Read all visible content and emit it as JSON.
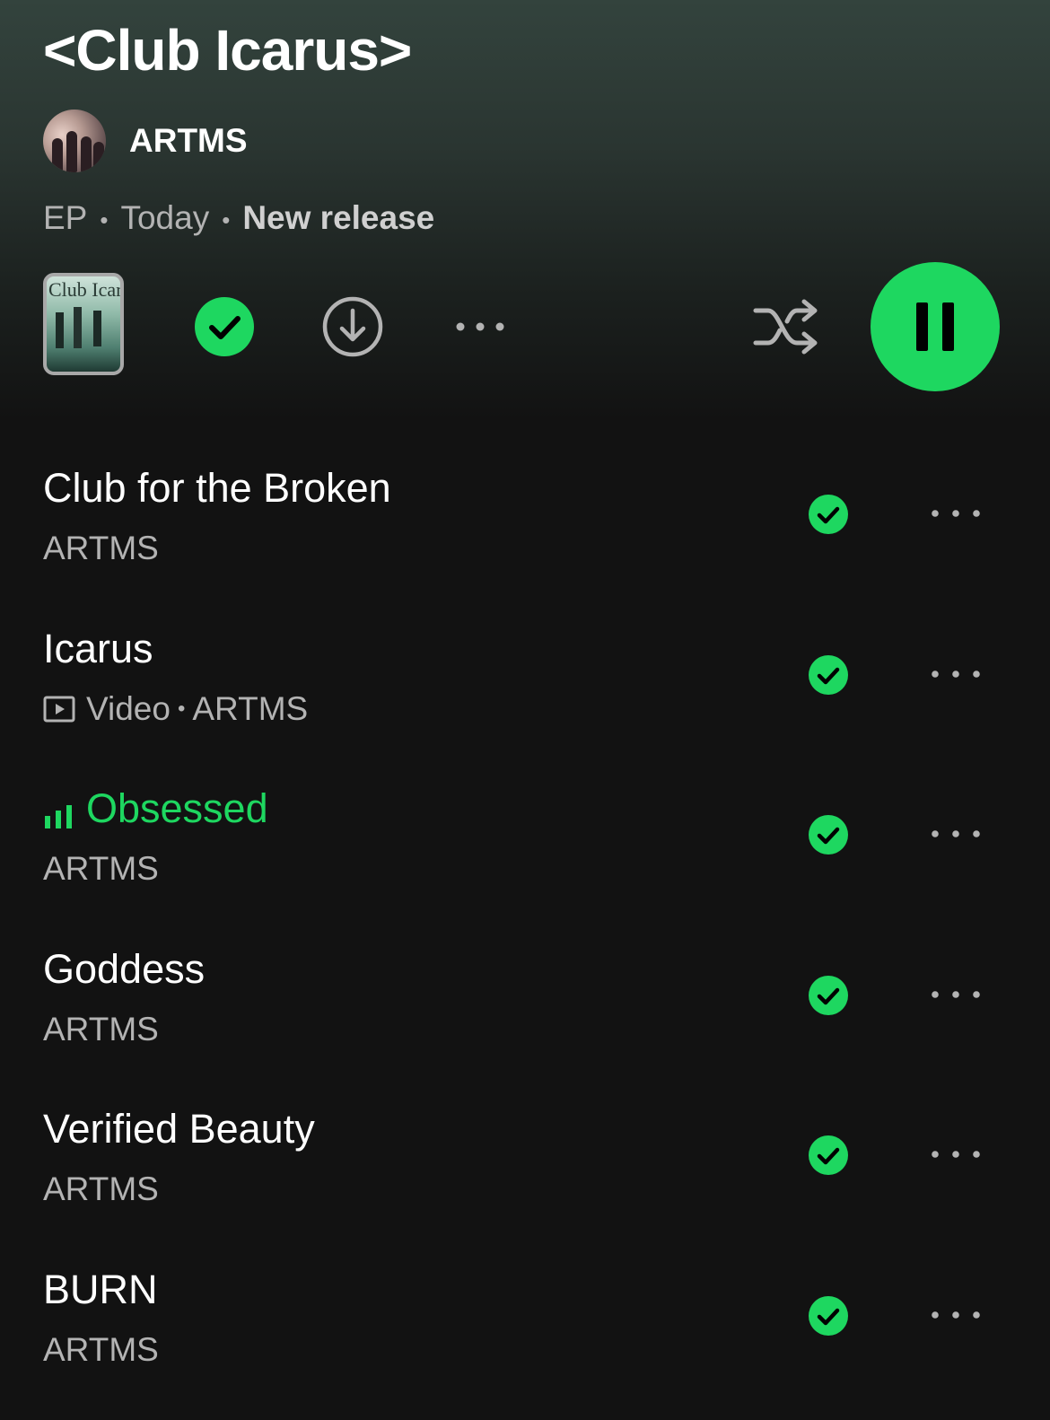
{
  "album": {
    "title": "<Club Icarus>",
    "artist": "ARTMS",
    "type": "EP",
    "date": "Today",
    "tag": "New release",
    "cover_text": "Club Icarus"
  },
  "colors": {
    "accent": "#1ed760",
    "background": "#121212",
    "secondary_text": "#b3b3b3"
  },
  "controls": {
    "saved_icon": "check-circle-icon",
    "download_icon": "download-icon",
    "more_icon": "more-options-icon",
    "shuffle_icon": "shuffle-icon",
    "play_state_icon": "pause-icon"
  },
  "tracks": [
    {
      "title": "Club for the Broken",
      "artist": "ARTMS",
      "video": false,
      "playing": false
    },
    {
      "title": "Icarus",
      "artist": "ARTMS",
      "video": true,
      "video_label": "Video",
      "playing": false
    },
    {
      "title": "Obsessed",
      "artist": "ARTMS",
      "video": false,
      "playing": true
    },
    {
      "title": "Goddess",
      "artist": "ARTMS",
      "video": false,
      "playing": false
    },
    {
      "title": "Verified Beauty",
      "artist": "ARTMS",
      "video": false,
      "playing": false
    },
    {
      "title": "BURN",
      "artist": "ARTMS",
      "video": false,
      "playing": false
    }
  ]
}
